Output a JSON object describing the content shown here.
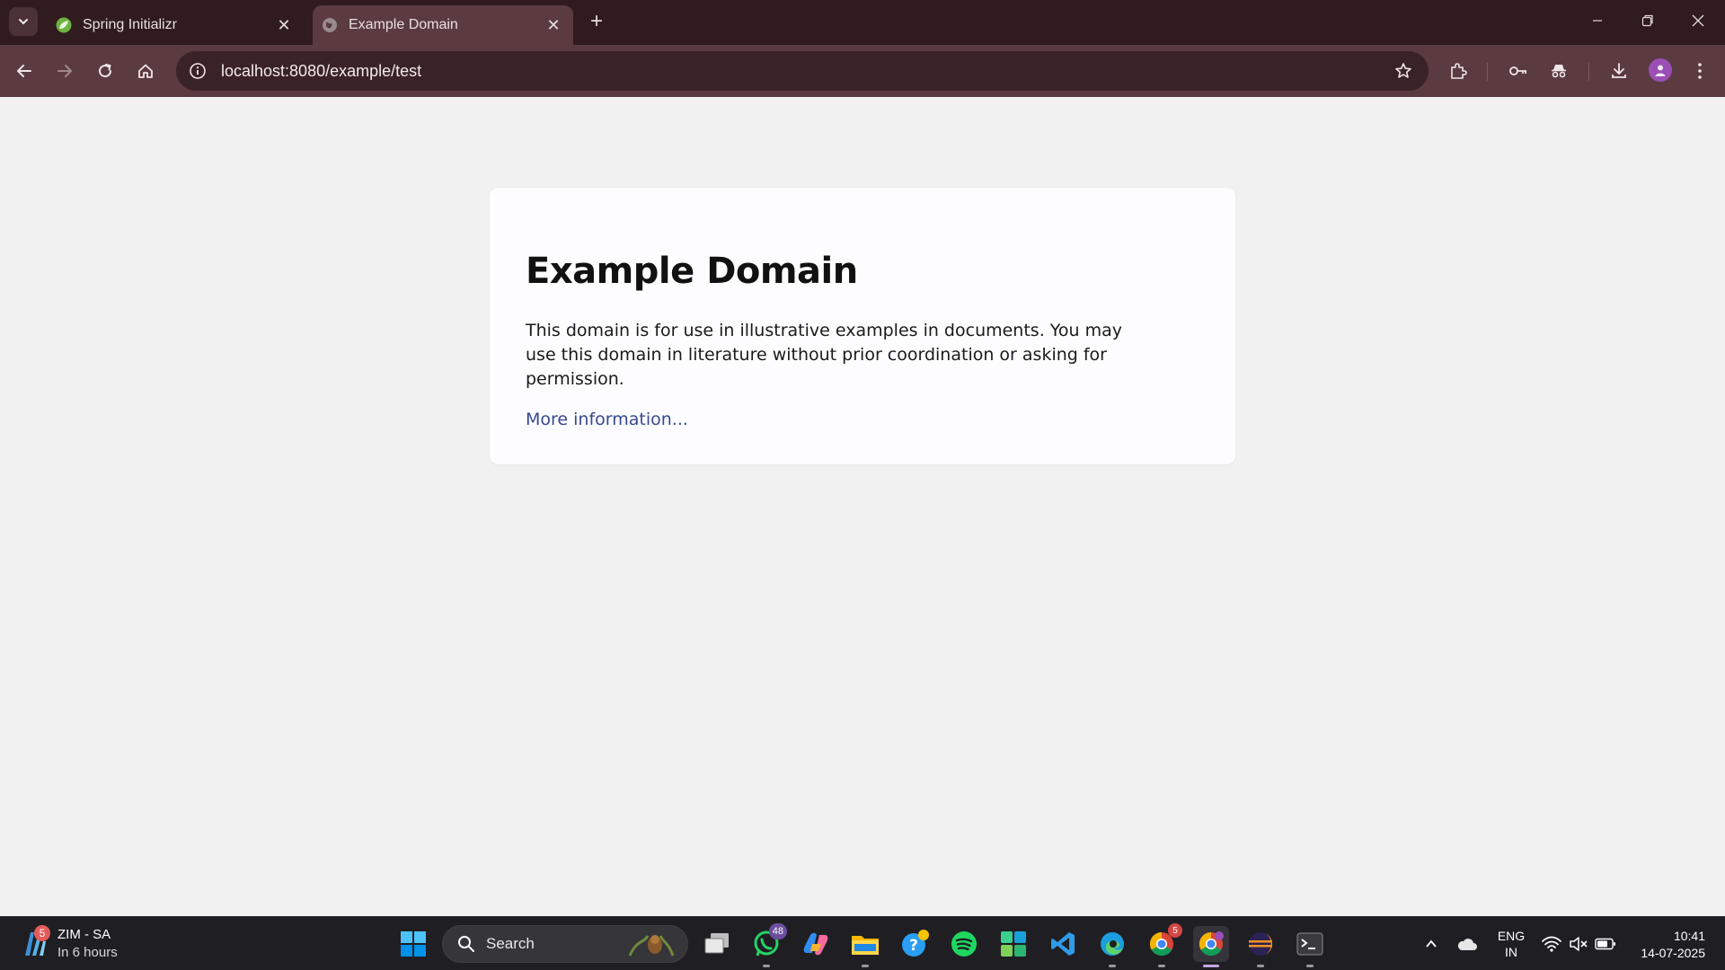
{
  "browser": {
    "tabs": [
      {
        "title": "Spring Initializr",
        "active": false
      },
      {
        "title": "Example Domain",
        "active": true
      }
    ],
    "url": "localhost:8080/example/test"
  },
  "page": {
    "heading": "Example Domain",
    "paragraph": "This domain is for use in illustrative examples in documents. You may use this domain in literature without prior coordination or asking for permission.",
    "link": "More information..."
  },
  "taskbar": {
    "weather": {
      "badge": "5",
      "title": "ZIM - SA",
      "subtitle": "In 6 hours"
    },
    "search_placeholder": "Search",
    "whatsapp_badge": "48",
    "chrome_badge": "5",
    "language": {
      "line1": "ENG",
      "line2": "IN"
    },
    "clock": {
      "time": "10:41",
      "date": "14-07-2025"
    }
  },
  "colors": {
    "titlebar": "#301b1e",
    "toolbar": "#5b3b40",
    "link": "#38488f",
    "page_bg": "#f1f1f2"
  }
}
